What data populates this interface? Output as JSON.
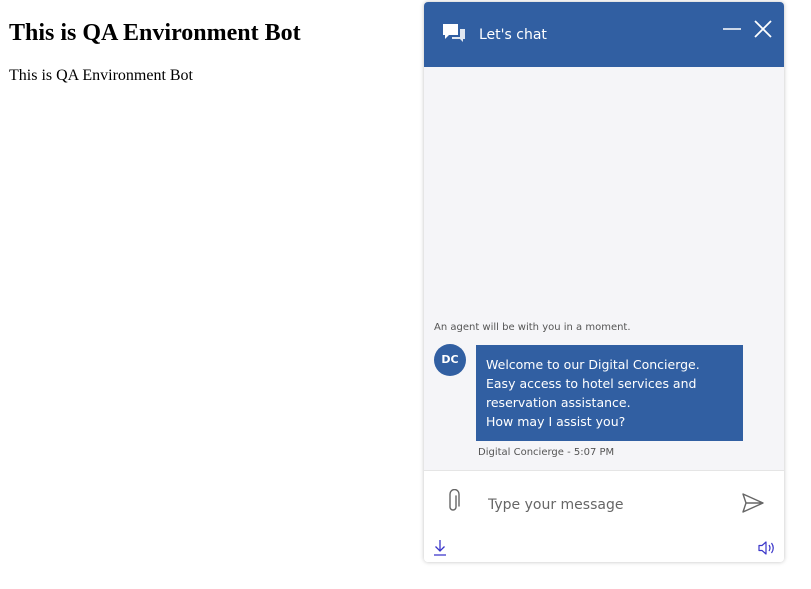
{
  "page": {
    "heading": "This is QA Environment Bot",
    "text": "This is QA Environment Bot"
  },
  "chat": {
    "header": {
      "title": "Let's chat",
      "icon": "chat-bubbles-icon",
      "minimize_icon": "minimize-icon",
      "close_icon": "close-icon"
    },
    "system_message": "An agent will be with you in a moment.",
    "messages": [
      {
        "avatar_initials": "DC",
        "lines": [
          "Welcome to our Digital Concierge. Easy access to hotel services and reservation assistance.",
          "How may I assist you?"
        ],
        "meta": "Digital Concierge - 5:07 PM"
      }
    ],
    "input": {
      "placeholder": "Type your message",
      "value": ""
    },
    "footer_icons": [
      "paperclip-icon",
      "send-icon",
      "download-icon",
      "speaker-icon"
    ]
  },
  "colors": {
    "brand": "#315fa2",
    "chat_bg": "#f5f5f8",
    "footer_icon_accent": "#3a35c9"
  }
}
